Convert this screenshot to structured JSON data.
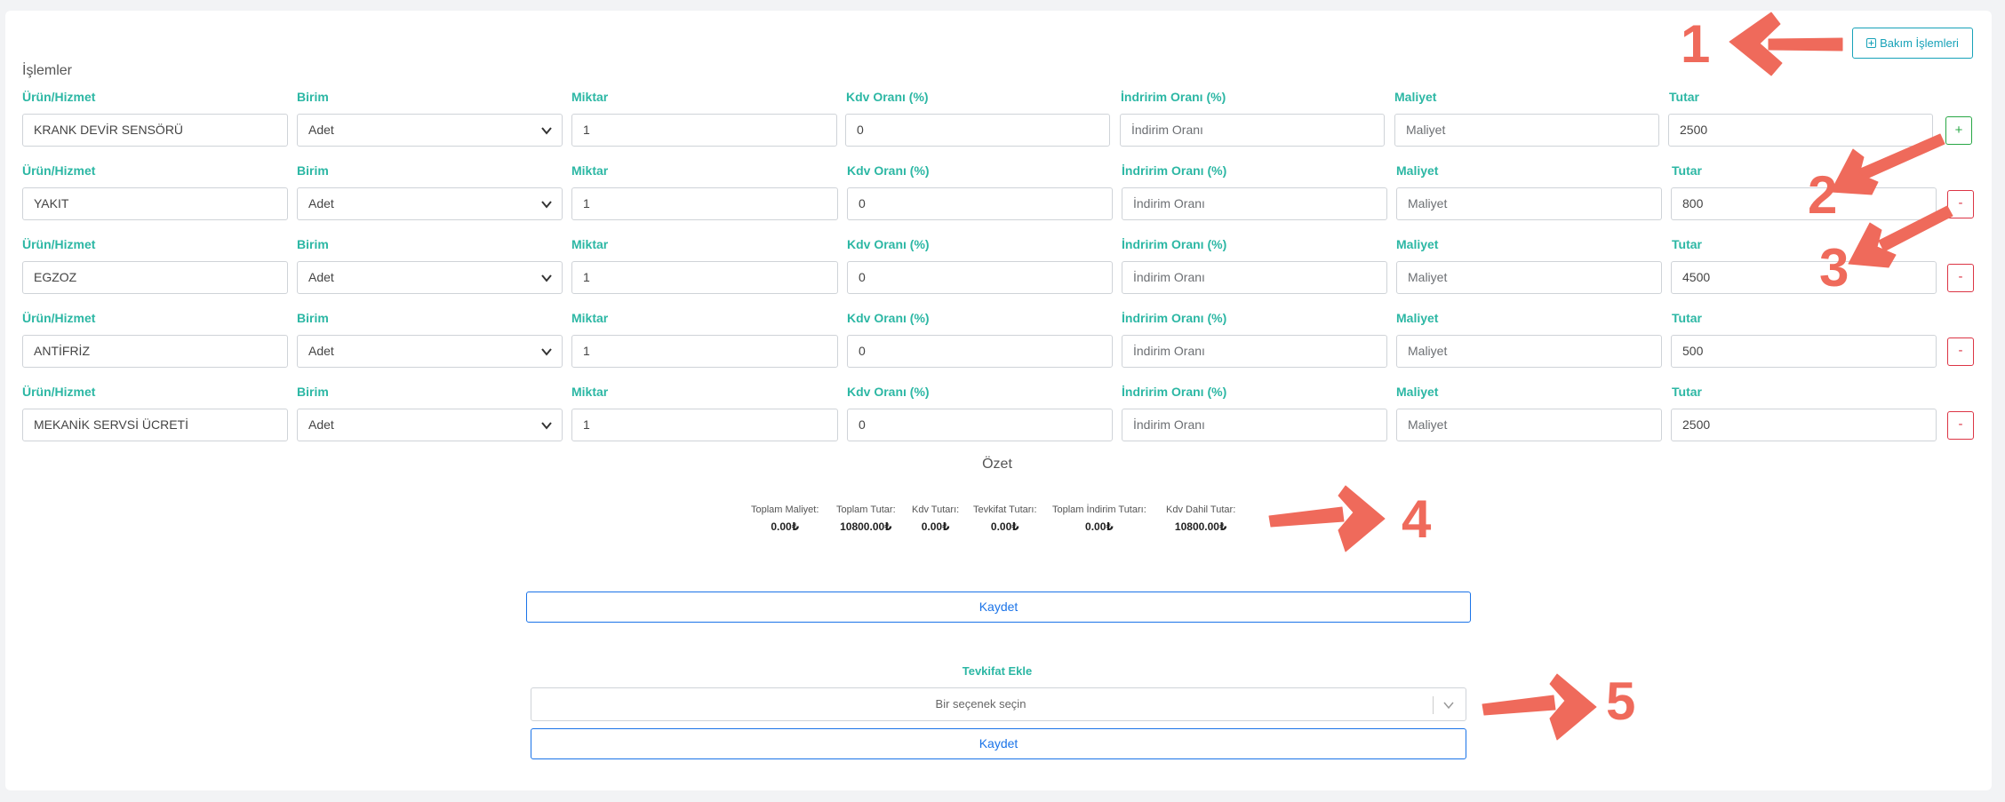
{
  "header": {
    "maintenance_button_label": "Bakım İşlemleri",
    "section_title": "İşlemler"
  },
  "columns": {
    "product": "Ürün/Hizmet",
    "unit": "Birim",
    "quantity": "Miktar",
    "vat": "Kdv Oranı (%)",
    "discount": "İndririm Oranı (%)",
    "cost": "Maliyet",
    "total": "Tutar"
  },
  "placeholders": {
    "discount": "İndirim Oranı",
    "cost": "Maliyet"
  },
  "rows": [
    {
      "product": "KRANK DEVİR SENSÖRÜ",
      "unit": "Adet",
      "quantity": "1",
      "vat": "0",
      "total": "2500",
      "action": "+"
    },
    {
      "product": "YAKIT",
      "unit": "Adet",
      "quantity": "1",
      "vat": "0",
      "total": "800",
      "action": "-"
    },
    {
      "product": "EGZOZ",
      "unit": "Adet",
      "quantity": "1",
      "vat": "0",
      "total": "4500",
      "action": "-"
    },
    {
      "product": "ANTİFRİZ",
      "unit": "Adet",
      "quantity": "1",
      "vat": "0",
      "total": "500",
      "action": "-"
    },
    {
      "product": "MEKANİK SERVSİ ÜCRETİ",
      "unit": "Adet",
      "quantity": "1",
      "vat": "0",
      "total": "2500",
      "action": "-"
    }
  ],
  "summary": {
    "title": "Özet",
    "items": [
      {
        "label": "Toplam Maliyet:",
        "value": "0.00₺"
      },
      {
        "label": "Toplam Tutar:",
        "value": "10800.00₺"
      },
      {
        "label": "Kdv Tutarı:",
        "value": "0.00₺"
      },
      {
        "label": "Tevkifat Tutarı:",
        "value": "0.00₺"
      },
      {
        "label": "Toplam İndirim Tutarı:",
        "value": "0.00₺"
      },
      {
        "label": "Kdv Dahil Tutar:",
        "value": "10800.00₺"
      }
    ],
    "save_label": "Kaydet"
  },
  "withholding": {
    "title": "Tevkifat Ekle",
    "placeholder": "Bir seçenek seçin",
    "save_label": "Kaydet"
  },
  "annotations": [
    "1",
    "2",
    "3",
    "4",
    "5"
  ],
  "colors": {
    "accent_teal": "#2cb7a4",
    "info": "#17a2b8",
    "primary": "#1a73e8",
    "success": "#28a745",
    "danger": "#dc3545",
    "annotation": "#ef6a5b"
  }
}
